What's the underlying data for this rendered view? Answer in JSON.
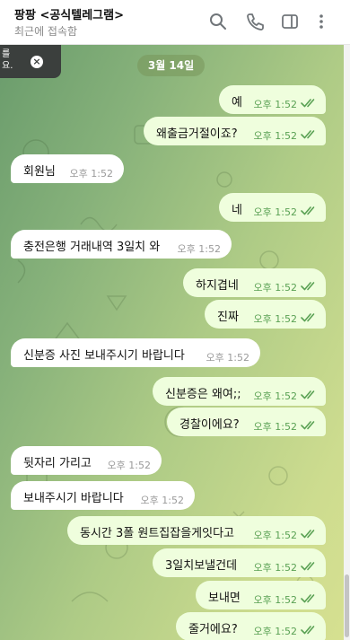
{
  "header": {
    "title": "팡팡 <공식텔레그램>",
    "status": "최근에 접속함",
    "icons": [
      "search-icon",
      "phone-icon",
      "sidebar-toggle-icon",
      "more-icon"
    ]
  },
  "toast": {
    "line1": "를",
    "line2": "요."
  },
  "date_chip": "3월 14일",
  "messages": [
    {
      "dir": "out",
      "text": "예",
      "time": "오후 1:52"
    },
    {
      "dir": "out",
      "text": "왜출금거절이죠?",
      "time": "오후 1:52"
    },
    {
      "dir": "in",
      "text": "회원님",
      "time": "오후 1:52"
    },
    {
      "dir": "out",
      "text": "네",
      "time": "오후 1:52"
    },
    {
      "dir": "in",
      "text": "충전은행 거래내역 3일치 와",
      "time": "오후 1:52"
    },
    {
      "dir": "out",
      "text": "하지겹네",
      "time": "오후 1:52"
    },
    {
      "dir": "out",
      "text": "진짜",
      "time": "오후 1:52"
    },
    {
      "dir": "in",
      "text": "신분증 사진 보내주시기 바랍니다",
      "time": "오후 1:52"
    },
    {
      "dir": "out",
      "text": "신분증은 왜여;;",
      "time": "오후 1:52"
    },
    {
      "dir": "out",
      "text": "경찰이에요?",
      "time": "오후 1:52"
    },
    {
      "dir": "in",
      "text": "뒷자리 가리고",
      "time": "오후 1:52"
    },
    {
      "dir": "in",
      "text": "보내주시기 바랍니다",
      "time": "오후 1:52"
    },
    {
      "dir": "out",
      "text": "동시간 3폴 원트집잡을게잇다고",
      "time": "오후 1:52"
    },
    {
      "dir": "out",
      "text": "3일치보낼건데",
      "time": "오후 1:52"
    },
    {
      "dir": "out",
      "text": "보내면",
      "time": "오후 1:52"
    },
    {
      "dir": "out",
      "text": "줄거에요?",
      "time": "오후 1:52"
    }
  ],
  "colors": {
    "outgoing_bubble": "#effedd",
    "incoming_bubble": "#ffffff",
    "read_check": "#5aa154"
  }
}
